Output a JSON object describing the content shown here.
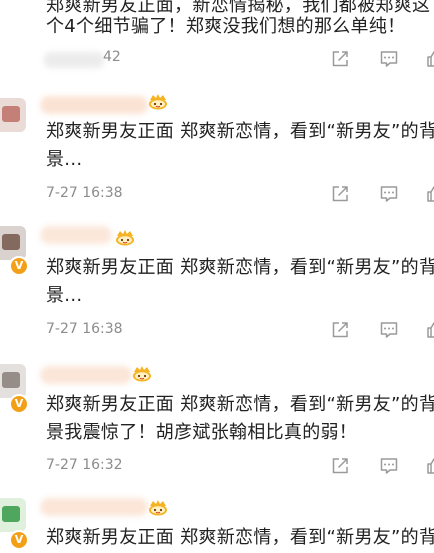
{
  "posts": [
    {
      "text_line1": "郑爽新男友正面，新恋情揭秘，我们都被郑爽这",
      "text_line2": "个4个细节骗了！郑爽没我们想的那么单纯！",
      "time": "42"
    },
    {
      "text_line1": "郑爽新男友正面 郑爽新恋情，看到“新男友”的背",
      "text_line2": "景...",
      "time": "7-27 16:38"
    },
    {
      "text_line1": "郑爽新男友正面 郑爽新恋情，看到“新男友”的背",
      "text_line2": "景...",
      "time": "7-27 16:38"
    },
    {
      "text_line1": "郑爽新男友正面 郑爽新恋情，看到“新男友”的背",
      "text_line2": "景我震惊了！胡彦斌张翰相比真的弱！",
      "time": "7-27 16:32"
    },
    {
      "text_line1": "郑爽新男友正面 郑爽新恋情，看到“新男友”的背"
    }
  ],
  "icons": {
    "verified": "v-badge",
    "vip": "crown-icon",
    "share": "share-icon",
    "comment": "comment-icon",
    "like": "like-icon"
  },
  "colors": {
    "text": "#222222",
    "meta": "#8c8c8c",
    "icon": "#9a9a9a",
    "verified": "#f3a018",
    "crown": "#f5b324",
    "name_blur": "#fbe6d8"
  }
}
